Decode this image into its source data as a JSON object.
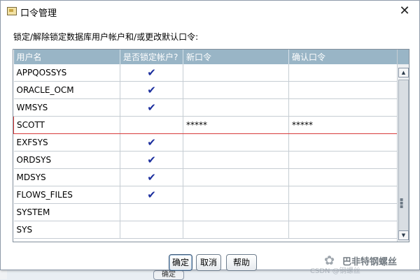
{
  "window": {
    "title": "口令管理",
    "close_glyph": "✕"
  },
  "instruction": "锁定/解除锁定数据库用户帐户和/或更改默认口令:",
  "table": {
    "columns": [
      "用户名",
      "是否锁定帐户?",
      "新口令",
      "确认口令"
    ],
    "rows": [
      {
        "user": "APPQOSSYS",
        "locked": "✔",
        "new_pw": "",
        "confirm_pw": ""
      },
      {
        "user": "ORACLE_OCM",
        "locked": "✔",
        "new_pw": "",
        "confirm_pw": ""
      },
      {
        "user": "WMSYS",
        "locked": "✔",
        "new_pw": "",
        "confirm_pw": ""
      },
      {
        "user": "SCOTT",
        "locked": "",
        "new_pw": "*****",
        "confirm_pw": "*****"
      },
      {
        "user": "EXFSYS",
        "locked": "✔",
        "new_pw": "",
        "confirm_pw": ""
      },
      {
        "user": "ORDSYS",
        "locked": "✔",
        "new_pw": "",
        "confirm_pw": ""
      },
      {
        "user": "MDSYS",
        "locked": "✔",
        "new_pw": "",
        "confirm_pw": ""
      },
      {
        "user": "FLOWS_FILES",
        "locked": "✔",
        "new_pw": "",
        "confirm_pw": ""
      },
      {
        "user": "SYSTEM",
        "locked": "",
        "new_pw": "",
        "confirm_pw": ""
      },
      {
        "user": "SYS",
        "locked": "",
        "new_pw": "",
        "confirm_pw": ""
      }
    ]
  },
  "buttons": {
    "ok": "确定",
    "cancel": "取消",
    "help": "帮助"
  },
  "scroll": {
    "up_glyph": "▲",
    "down_glyph": "▼"
  },
  "background": {
    "partial_button": "确定"
  },
  "watermark": {
    "name": "巴非特钢螺丝",
    "sub": "CSDN @钢螺丝"
  },
  "colors": {
    "header_bg": "#99b5c6",
    "check": "#1c2f9e",
    "selected_border": "#d73a3a"
  }
}
